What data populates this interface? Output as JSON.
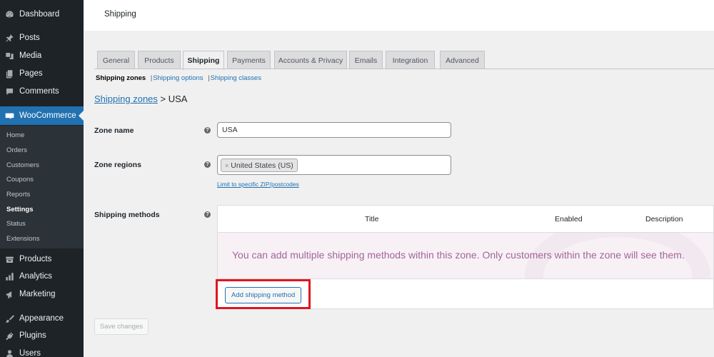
{
  "sidebar": {
    "items": [
      {
        "label": "Dashboard",
        "icon": "dashboard-icon"
      },
      {
        "label": "Posts",
        "icon": "pin-icon"
      },
      {
        "label": "Media",
        "icon": "media-icon"
      },
      {
        "label": "Pages",
        "icon": "pages-icon"
      },
      {
        "label": "Comments",
        "icon": "comment-icon"
      },
      {
        "label": "WooCommerce",
        "icon": "woo-icon",
        "active": true
      },
      {
        "label": "Products",
        "icon": "archive-icon"
      },
      {
        "label": "Analytics",
        "icon": "bar-chart-icon"
      },
      {
        "label": "Marketing",
        "icon": "megaphone-icon"
      },
      {
        "label": "Appearance",
        "icon": "brush-icon"
      },
      {
        "label": "Plugins",
        "icon": "plug-icon"
      },
      {
        "label": "Users",
        "icon": "user-icon"
      }
    ],
    "submenu": [
      {
        "label": "Home"
      },
      {
        "label": "Orders"
      },
      {
        "label": "Customers"
      },
      {
        "label": "Coupons"
      },
      {
        "label": "Reports"
      },
      {
        "label": "Settings",
        "current": true
      },
      {
        "label": "Status"
      },
      {
        "label": "Extensions"
      }
    ]
  },
  "header": {
    "title": "Shipping"
  },
  "tabs": [
    {
      "label": "General"
    },
    {
      "label": "Products"
    },
    {
      "label": "Shipping",
      "active": true
    },
    {
      "label": "Payments"
    },
    {
      "label": "Accounts & Privacy"
    },
    {
      "label": "Emails"
    },
    {
      "label": "Integration"
    },
    {
      "label": "Advanced"
    }
  ],
  "subnav": {
    "current": "Shipping zones",
    "links": [
      "Shipping options",
      "Shipping classes"
    ],
    "separator": "|"
  },
  "breadcrumb": {
    "link": "Shipping zones",
    "rest": " > USA"
  },
  "form": {
    "zone_name": {
      "label": "Zone name",
      "value": "USA"
    },
    "zone_regions": {
      "label": "Zone regions",
      "chip_remove": "×",
      "chip": "United States (US)",
      "limit_link": "Limit to specific ZIP/postcodes"
    },
    "shipping_methods": {
      "label": "Shipping methods",
      "columns": [
        "Title",
        "Enabled",
        "Description"
      ],
      "empty_message": "You can add multiple shipping methods within this zone. Only customers within the zone will see them.",
      "add_button": "Add shipping method"
    },
    "help_glyph": "?"
  },
  "save_button": "Save changes",
  "colors": {
    "accent": "#2271b1",
    "woo_purple": "#a46497",
    "highlight": "#e0161f",
    "sidebar": "#1d2327"
  }
}
